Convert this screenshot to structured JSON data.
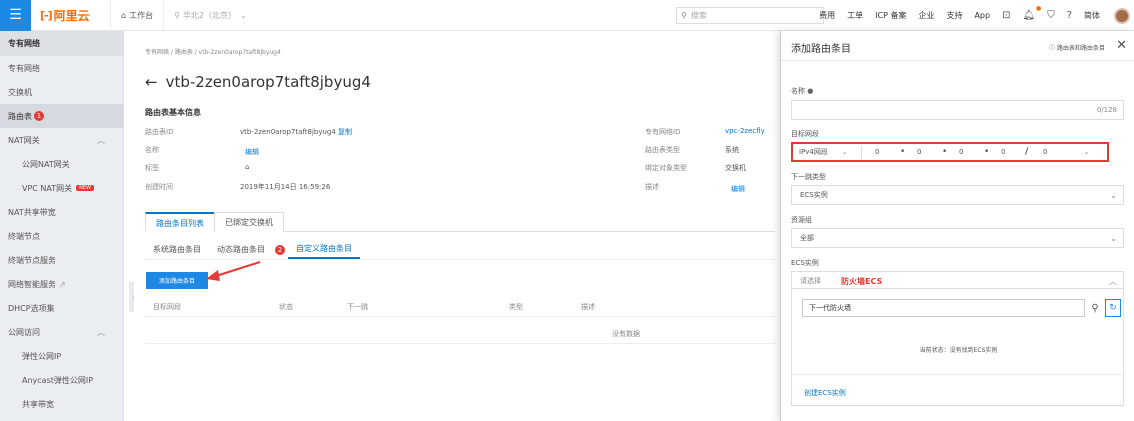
{
  "topbar": {
    "logo_mark": "[-]",
    "logo_text": "阿里云",
    "workbench": "工作台",
    "region": "华北2（北京）",
    "search_placeholder": "搜索",
    "links": [
      "费用",
      "工单",
      "ICP 备案",
      "企业",
      "支持",
      "App"
    ],
    "lang": "简体"
  },
  "sidebar": {
    "title": "专有网络",
    "items": [
      {
        "label": "专有网络"
      },
      {
        "label": "交换机"
      },
      {
        "label": "路由表",
        "badge": "1"
      },
      {
        "label": "NAT网关"
      },
      {
        "label": "公网NAT网关"
      },
      {
        "label": "VPC NAT网关",
        "tag": "NEW"
      },
      {
        "label": "NAT共享带宽"
      },
      {
        "label": "终端节点"
      },
      {
        "label": "终端节点服务"
      },
      {
        "label": "网络智能服务"
      },
      {
        "label": "DHCP选项集"
      },
      {
        "label": "公网访问"
      },
      {
        "label": "弹性公网IP"
      },
      {
        "label": "Anycast弹性公网IP"
      },
      {
        "label": "共享带宽"
      }
    ]
  },
  "main": {
    "breadcrumb": "专有网络 / 路由表 / vtb-2zen0arop7taft8jbyug4",
    "title": "vtb-2zen0arop7taft8jbyug4",
    "section_title": "路由表基本信息",
    "info": {
      "id_label": "路由表ID",
      "id_value": "vtb-2zen0arop7taft8jbyug4",
      "copy": "复制",
      "name_label": "名称",
      "edit": "编辑",
      "tag_label": "标签",
      "created_label": "创建时间",
      "created_value": "2019年11月14日 16:59:26",
      "vpc_label": "专有网络ID",
      "vpc_value": "vpc-2zecfly",
      "type_label": "路由表类型",
      "type_value": "系统",
      "bind_type_label": "绑定对象类型",
      "bind_type_value": "交换机",
      "desc_label": "描述",
      "desc_edit": "编辑"
    },
    "tabs": [
      "路由条目列表",
      "已绑定交换机"
    ],
    "subtabs": [
      "系统路由条目",
      "动态路由条目",
      "自定义路由条目"
    ],
    "subtab_badge": "2",
    "add_button": "添加路由条目",
    "columns": [
      "目标网段",
      "状态",
      "下一跳",
      "类型",
      "描述"
    ],
    "no_data": "没有数据"
  },
  "panel": {
    "title": "添加路由条目",
    "help": "路由表和路由条目",
    "name_label": "名称",
    "name_counter": "0/128",
    "target_label": "目标网段",
    "ip_type": "IPv4网段",
    "octets": [
      "0",
      "0",
      "0",
      "0"
    ],
    "mask": "0",
    "next_hop_label": "下一跳类型",
    "next_hop_value": "ECS实例",
    "resource_group_label": "资源组",
    "resource_group_value": "全部",
    "ecs_label": "ECS实例",
    "ecs_placeholder": "请选择",
    "ecs_note": "防火墙ECS",
    "dd_search_value": "下一代防火墙",
    "dd_status": "当前状态：没有找到ECS实例",
    "dd_create": "创建ECS实例"
  }
}
